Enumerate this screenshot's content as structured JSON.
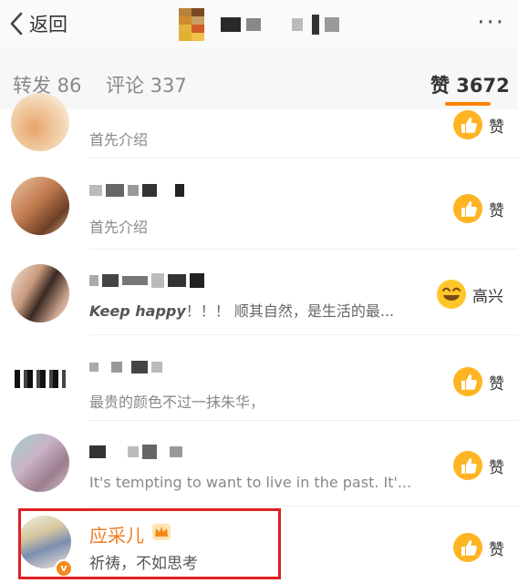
{
  "header": {
    "back_label": "返回",
    "more_label": "···"
  },
  "tabs": [
    {
      "label": "转发 86",
      "active": false
    },
    {
      "label": "评论 337",
      "active": false
    },
    {
      "label": "赞 3672",
      "active": true
    }
  ],
  "accent_color": "#ff8200",
  "highlight_color": "#e02020",
  "rows": [
    {
      "comment": "首先介绍",
      "reaction": "赞",
      "reaction_icon": "thumbs-up-icon"
    },
    {
      "comment": "首先介绍",
      "reaction": "赞",
      "reaction_icon": "thumbs-up-icon"
    },
    {
      "comment_italic": "Keep happy",
      "comment": "！！！ 顺其自然，是生活的最...",
      "reaction": "高兴",
      "reaction_icon": "happy-face-icon"
    },
    {
      "comment": "最贵的颜色不过一抹朱华，",
      "reaction": "赞",
      "reaction_icon": "thumbs-up-icon"
    },
    {
      "comment": "It's tempting to want to live in the past. It'...",
      "reaction": "赞",
      "reaction_icon": "thumbs-up-icon"
    }
  ],
  "highlighted_user": {
    "name": "应采儿",
    "comment": "祈祷，不如思考",
    "badge": "v",
    "reaction": "赞",
    "reaction_icon": "thumbs-up-icon"
  }
}
